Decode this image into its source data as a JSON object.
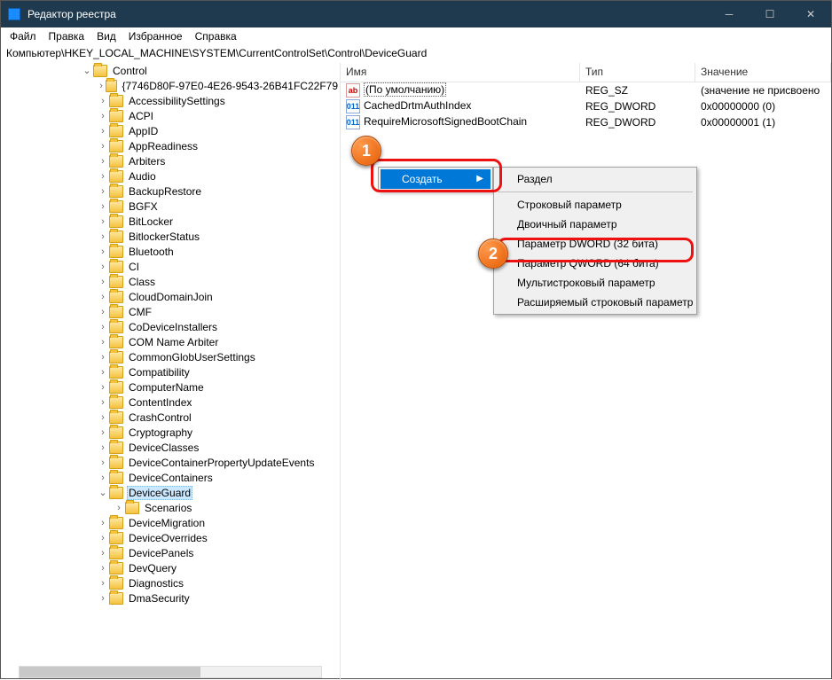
{
  "window": {
    "title": "Редактор реестра"
  },
  "menubar": {
    "file": "Файл",
    "edit": "Правка",
    "view": "Вид",
    "fav": "Избранное",
    "help": "Справка"
  },
  "address": "Компьютер\\HKEY_LOCAL_MACHINE\\SYSTEM\\CurrentControlSet\\Control\\DeviceGuard",
  "columns": {
    "name": "Имя",
    "type": "Тип",
    "value": "Значение"
  },
  "values": [
    {
      "icon": "str",
      "name": "(По умолчанию)",
      "type": "REG_SZ",
      "data": "(значение не присвоено",
      "default": true
    },
    {
      "icon": "bin",
      "name": "CachedDrtmAuthIndex",
      "type": "REG_DWORD",
      "data": "0x00000000 (0)"
    },
    {
      "icon": "bin",
      "name": "RequireMicrosoftSignedBootChain",
      "type": "REG_DWORD",
      "data": "0x00000001 (1)"
    }
  ],
  "tree": {
    "root": "Control",
    "items": [
      "{7746D80F-97E0-4E26-9543-26B41FC22F79",
      "AccessibilitySettings",
      "ACPI",
      "AppID",
      "AppReadiness",
      "Arbiters",
      "Audio",
      "BackupRestore",
      "BGFX",
      "BitLocker",
      "BitlockerStatus",
      "Bluetooth",
      "CI",
      "Class",
      "CloudDomainJoin",
      "CMF",
      "CoDeviceInstallers",
      "COM Name Arbiter",
      "CommonGlobUserSettings",
      "Compatibility",
      "ComputerName",
      "ContentIndex",
      "CrashControl",
      "Cryptography",
      "DeviceClasses",
      "DeviceContainerPropertyUpdateEvents",
      "DeviceContainers"
    ],
    "selected": "DeviceGuard",
    "selected_children": [
      "Scenarios"
    ],
    "after": [
      "DeviceMigration",
      "DeviceOverrides",
      "DevicePanels",
      "DevQuery",
      "Diagnostics",
      "DmaSecurity"
    ]
  },
  "ctx1": {
    "create": "Создать"
  },
  "ctx2": {
    "section": "Раздел",
    "string": "Строковый параметр",
    "binary": "Двоичный параметр",
    "dword": "Параметр DWORD (32 бита)",
    "qword": "Параметр QWORD (64 бита)",
    "multi": "Мультистроковый параметр",
    "expand": "Расширяемый строковый параметр"
  },
  "callouts": {
    "one": "1",
    "two": "2"
  }
}
